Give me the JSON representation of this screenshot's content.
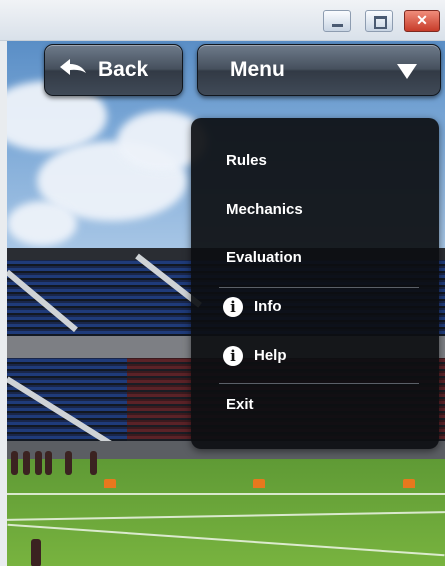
{
  "window_controls": {
    "minimize_icon": "minimize-icon",
    "maximize_icon": "maximize-icon",
    "close_glyph": "✕"
  },
  "header": {
    "back_label": "Back",
    "menu_label": "Menu"
  },
  "menu": {
    "items": [
      {
        "label": "Rules"
      },
      {
        "label": "Mechanics"
      },
      {
        "label": "Evaluation"
      },
      {
        "label": "Info",
        "icon": "info-icon"
      },
      {
        "label": "Help",
        "icon": "info-icon"
      },
      {
        "label": "Exit"
      }
    ],
    "info_glyph": "i"
  },
  "colors": {
    "button": "#404a57",
    "dropdown_bg": "#0c0e11",
    "close_button": "#c73c2a",
    "field": "#6ea83b"
  }
}
